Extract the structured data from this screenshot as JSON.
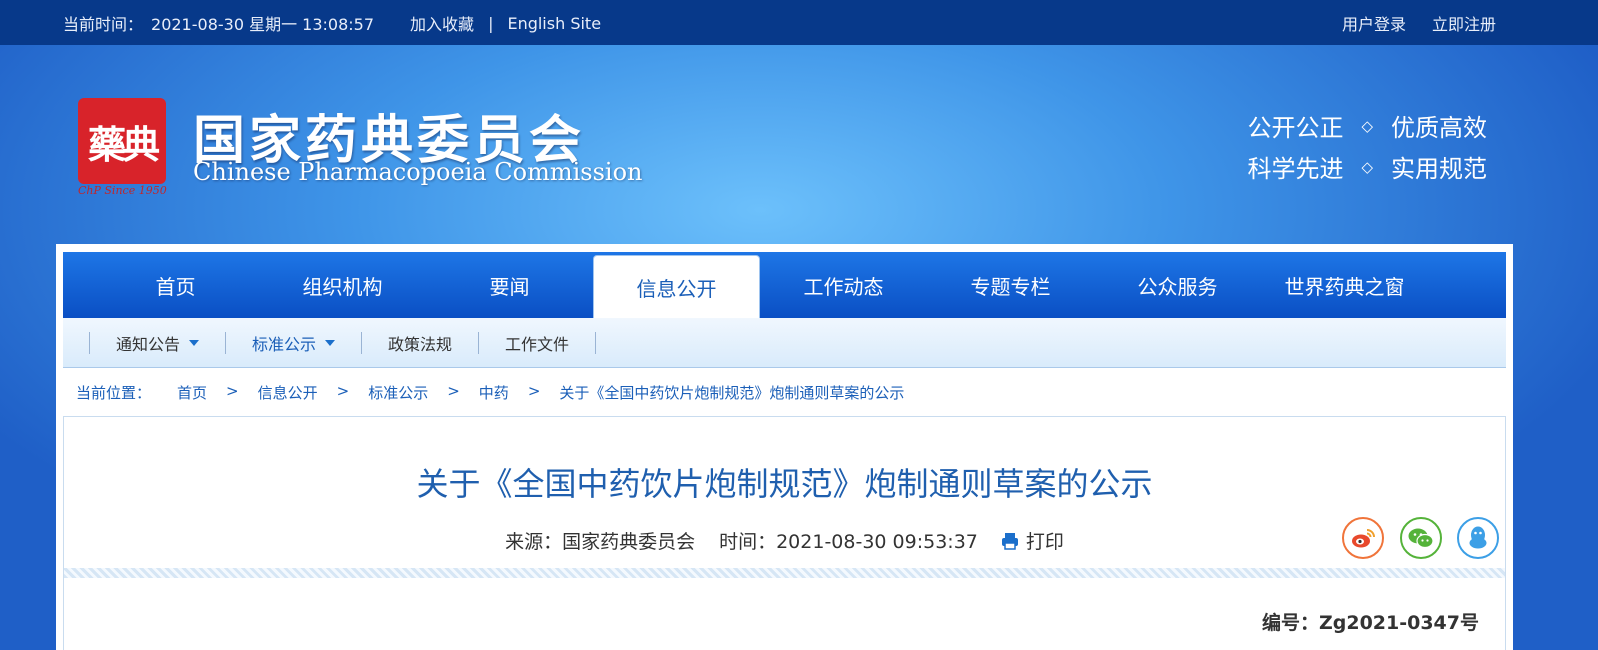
{
  "topbar": {
    "time_label": "当前时间：",
    "time_value": "2021-08-30 星期一 13:08:57",
    "bookmark": "加入收藏",
    "separator": "|",
    "english_site": "English Site",
    "login": "用户登录",
    "register": "立即注册"
  },
  "header": {
    "seal_text": "藥典",
    "seal_caption": "ChP Since 1950",
    "title_cn": "国家药典委员会",
    "title_en": "Chinese Pharmacopoeia Commission",
    "slogan": [
      {
        "left": "公开公正",
        "right": "优质高效"
      },
      {
        "left": "科学先进",
        "right": "实用规范"
      }
    ],
    "diamond": "◇"
  },
  "nav": {
    "items": [
      "首页",
      "组织机构",
      "要闻",
      "信息公开",
      "工作动态",
      "专题专栏",
      "公众服务",
      "世界药典之窗"
    ],
    "active": "信息公开"
  },
  "subnav": {
    "items": [
      "通知公告",
      "标准公示",
      "政策法规",
      "工作文件"
    ]
  },
  "breadcrumb": {
    "label": "当前位置：",
    "gt": ">",
    "items": [
      "首页",
      "信息公开",
      "标准公示",
      "中药",
      "关于《全国中药饮片炮制规范》炮制通则草案的公示"
    ]
  },
  "article": {
    "title": "关于《全国中药饮片炮制规范》炮制通则草案的公示",
    "source": "来源：国家药典委员会",
    "time": "时间：2021-08-30 09:53:37",
    "print": "打印",
    "doc_number": "编号：Zg2021-0347号"
  },
  "colors": {
    "topbar": "#07398a",
    "nav": "#0a4fc4",
    "link": "#1b5fb8",
    "title": "#1f5fae",
    "seal": "#d8232a"
  }
}
